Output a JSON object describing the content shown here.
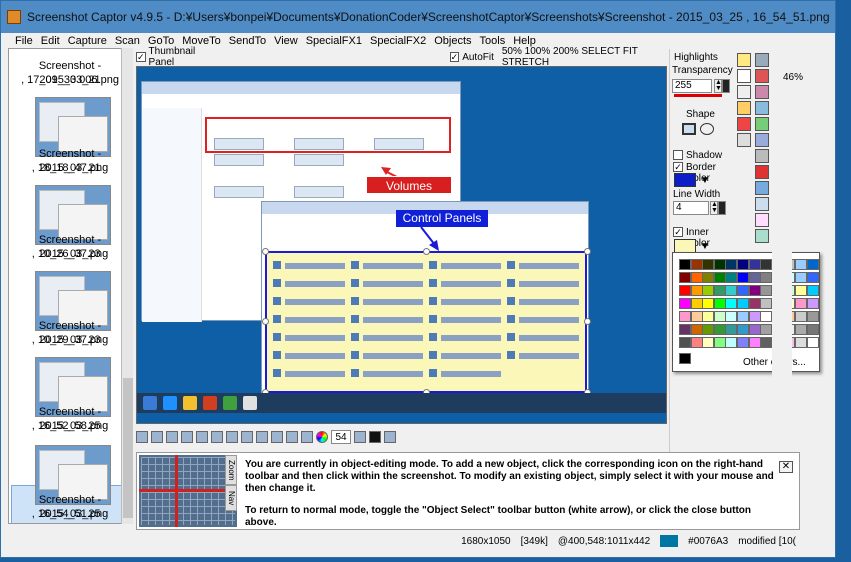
{
  "window": {
    "title": "Screenshot Captor v4.9.5 - D:¥Users¥bonpei¥Documents¥DonationCoder¥ScreenshotCaptor¥Screenshots¥Screenshot - 2015_03_25 , 16_54_51.png"
  },
  "menu": [
    "File",
    "Edit",
    "Capture",
    "Scan",
    "GoTo",
    "MoveTo",
    "SendTo",
    "View",
    "SpecialFX1",
    "SpecialFX2",
    "Objects",
    "Tools",
    "Help"
  ],
  "thumbnails": [
    {
      "label1": "Screenshot - 2015_03_21",
      "label2": ", 17_09_33 006.png"
    },
    {
      "label1": "Screenshot - 2015_03_21",
      "label2": ", 18_18_47.png"
    },
    {
      "label1": "Screenshot - 2015_03_23",
      "label2": ", 10_26_37.png"
    },
    {
      "label1": "Screenshot - 2015_03_23",
      "label2": ", 10_29_37.png"
    },
    {
      "label1": "Screenshot - 2015_03_25",
      "label2": ", 16_52_58.png"
    },
    {
      "label1": "Screenshot - 2015_03_25",
      "label2": ", 16_54_51.png"
    }
  ],
  "toptools": {
    "thumbnail_panel": "Thumbnail Panel",
    "autofit": "AutoFit",
    "zoom_options": "50%  100%  200%  SELECT  FIT  STRETCH",
    "highlights": "Highlights"
  },
  "annotations": {
    "volumes": "Volumes",
    "control_panels": "Control Panels"
  },
  "rightpanel": {
    "transparency": "Transparency",
    "transparency_value": "255",
    "shape": "Shape",
    "shadow": "Shadow",
    "border_color": "Border Color",
    "line_width": "Line Width",
    "line_width_value": "4",
    "inner_color": "Inner Color",
    "other_colors": "Other colors..."
  },
  "zoom_percent": "46%",
  "bottomtools": {
    "size_value": "54"
  },
  "navigator": {
    "zoom_tab": "Zoom",
    "nav_tab": "Nav"
  },
  "info": {
    "line1": "You are currently in object-editing mode. To add a new object, click the corresponding icon on the right-hand toolbar and then click within the screenshot. To modify an existing object, simply select it with your mouse and then change it.",
    "line2": "To return to normal mode, toggle the \"Object Select\" toolbar button (white arrow), or click the close button above.",
    "close": "✕"
  },
  "status": {
    "dimensions": "1680x1050",
    "filesize": "[349k]",
    "coords": "@400,548:1011x442",
    "color": "#0076A3",
    "modified": "modified [10("
  },
  "colors": {
    "border": "#0d1ec8",
    "inner": "#fbf7b8",
    "status_color": "#0076a3"
  }
}
